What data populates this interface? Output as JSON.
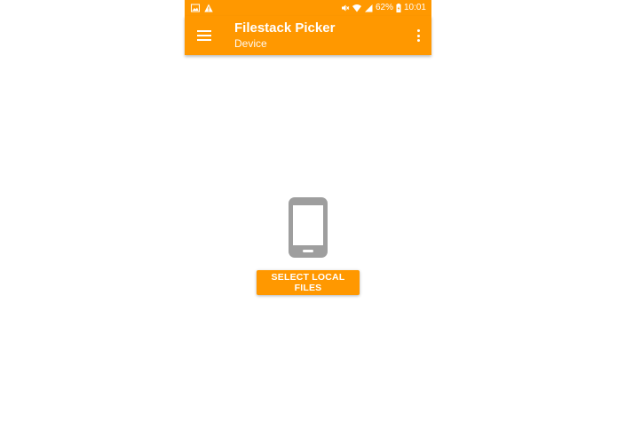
{
  "status_bar": {
    "battery_percent": "62%",
    "time": "10:01",
    "left_icons": [
      "gallery-icon",
      "warning-icon"
    ],
    "right_icons": [
      "mute-icon",
      "wifi-icon",
      "signal-icon",
      "battery-icon"
    ]
  },
  "app_bar": {
    "title": "Filestack Picker",
    "subtitle": "Device",
    "menu_icon": "hamburger-menu-icon",
    "overflow_icon": "more-vert-icon"
  },
  "main": {
    "device_icon": "smartphone-icon",
    "select_button_label": "SELECT LOCAL FILES"
  },
  "colors": {
    "accent": "#FF9800",
    "icon_gray": "#9E9E9E",
    "background": "#FFFFFF"
  }
}
